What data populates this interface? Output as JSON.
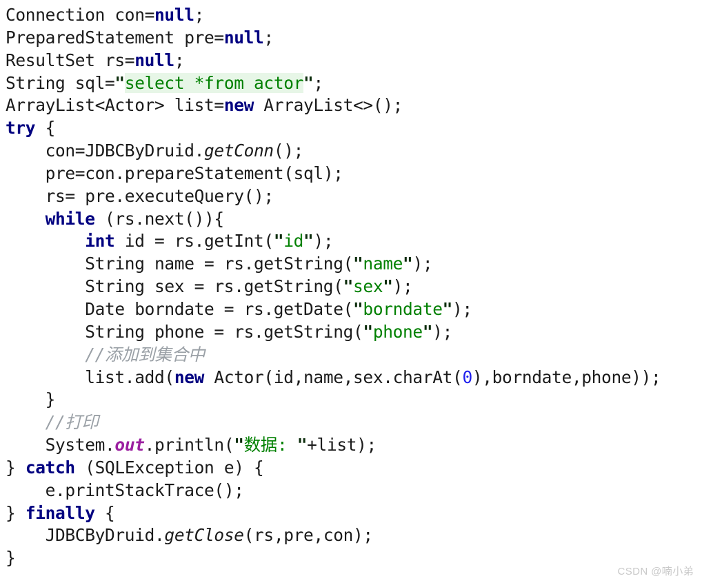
{
  "editor": {
    "language": "java",
    "background": "#ffffff",
    "colors": {
      "plain_text": "#1b1b1b",
      "keyword": "#000080",
      "string": "#008000",
      "string_quote": "#0c2d0c",
      "number": "#2020ee",
      "comment": "#9aa0a6",
      "static_field": "#9b1fa0",
      "sql_injection_highlight": "#e7f6e7",
      "watermark": "#c9c9c9"
    },
    "line_count": 25
  },
  "code": {
    "lines": [
      {
        "n": 1,
        "indent": 0,
        "tokens": [
          {
            "t": "plain",
            "v": "Connection con="
          },
          {
            "t": "kw",
            "v": "null"
          },
          {
            "t": "plain",
            "v": ";"
          }
        ]
      },
      {
        "n": 2,
        "indent": 0,
        "tokens": [
          {
            "t": "plain",
            "v": "PreparedStatement pre="
          },
          {
            "t": "kw",
            "v": "null"
          },
          {
            "t": "plain",
            "v": ";"
          }
        ]
      },
      {
        "n": 3,
        "indent": 0,
        "tokens": [
          {
            "t": "plain",
            "v": "ResultSet rs="
          },
          {
            "t": "kw",
            "v": "null"
          },
          {
            "t": "plain",
            "v": ";"
          }
        ]
      },
      {
        "n": 4,
        "indent": 0,
        "tokens": [
          {
            "t": "plain",
            "v": "String sql="
          },
          {
            "t": "strq",
            "v": "\""
          },
          {
            "t": "sql",
            "v": "select *from actor"
          },
          {
            "t": "strq",
            "v": "\""
          },
          {
            "t": "plain",
            "v": ";"
          }
        ]
      },
      {
        "n": 5,
        "indent": 0,
        "tokens": [
          {
            "t": "plain",
            "v": "ArrayList<Actor> list="
          },
          {
            "t": "kw",
            "v": "new"
          },
          {
            "t": "plain",
            "v": " ArrayList<>();"
          }
        ]
      },
      {
        "n": 6,
        "indent": 0,
        "tokens": [
          {
            "t": "kw",
            "v": "try"
          },
          {
            "t": "plain",
            "v": " {"
          }
        ]
      },
      {
        "n": 7,
        "indent": 1,
        "tokens": [
          {
            "t": "plain",
            "v": "con=JDBCByDruid."
          },
          {
            "t": "method",
            "v": "getConn"
          },
          {
            "t": "plain",
            "v": "();"
          }
        ]
      },
      {
        "n": 8,
        "indent": 1,
        "tokens": [
          {
            "t": "plain",
            "v": "pre=con.prepareStatement(sql);"
          }
        ]
      },
      {
        "n": 9,
        "indent": 1,
        "tokens": [
          {
            "t": "plain",
            "v": "rs= pre.executeQuery();"
          }
        ]
      },
      {
        "n": 10,
        "indent": 1,
        "tokens": [
          {
            "t": "kw",
            "v": "while"
          },
          {
            "t": "plain",
            "v": " (rs.next()){"
          }
        ]
      },
      {
        "n": 11,
        "indent": 2,
        "tokens": [
          {
            "t": "kw",
            "v": "int"
          },
          {
            "t": "plain",
            "v": " id = rs.getInt("
          },
          {
            "t": "strq",
            "v": "\""
          },
          {
            "t": "str",
            "v": "id"
          },
          {
            "t": "strq",
            "v": "\""
          },
          {
            "t": "plain",
            "v": ");"
          }
        ]
      },
      {
        "n": 12,
        "indent": 2,
        "tokens": [
          {
            "t": "plain",
            "v": "String name = rs.getString("
          },
          {
            "t": "strq",
            "v": "\""
          },
          {
            "t": "str",
            "v": "name"
          },
          {
            "t": "strq",
            "v": "\""
          },
          {
            "t": "plain",
            "v": ");"
          }
        ]
      },
      {
        "n": 13,
        "indent": 2,
        "tokens": [
          {
            "t": "plain",
            "v": "String sex = rs.getString("
          },
          {
            "t": "strq",
            "v": "\""
          },
          {
            "t": "str",
            "v": "sex"
          },
          {
            "t": "strq",
            "v": "\""
          },
          {
            "t": "plain",
            "v": ");"
          }
        ]
      },
      {
        "n": 14,
        "indent": 2,
        "tokens": [
          {
            "t": "plain",
            "v": "Date borndate = rs.getDate("
          },
          {
            "t": "strq",
            "v": "\""
          },
          {
            "t": "str",
            "v": "borndate"
          },
          {
            "t": "strq",
            "v": "\""
          },
          {
            "t": "plain",
            "v": ");"
          }
        ]
      },
      {
        "n": 15,
        "indent": 2,
        "tokens": [
          {
            "t": "plain",
            "v": "String phone = rs.getString("
          },
          {
            "t": "strq",
            "v": "\""
          },
          {
            "t": "str",
            "v": "phone"
          },
          {
            "t": "strq",
            "v": "\""
          },
          {
            "t": "plain",
            "v": ");"
          }
        ]
      },
      {
        "n": 16,
        "indent": 2,
        "tokens": [
          {
            "t": "cmt",
            "v": "//添加到集合中"
          }
        ]
      },
      {
        "n": 17,
        "indent": 2,
        "tokens": [
          {
            "t": "plain",
            "v": "list.add("
          },
          {
            "t": "kw",
            "v": "new"
          },
          {
            "t": "plain",
            "v": " Actor(id,name,sex.charAt("
          },
          {
            "t": "num",
            "v": "0"
          },
          {
            "t": "plain",
            "v": "),borndate,phone));"
          }
        ]
      },
      {
        "n": 18,
        "indent": 1,
        "tokens": [
          {
            "t": "plain",
            "v": "}"
          }
        ]
      },
      {
        "n": 19,
        "indent": 1,
        "tokens": [
          {
            "t": "cmt",
            "v": "//打印"
          }
        ]
      },
      {
        "n": 20,
        "indent": 1,
        "tokens": [
          {
            "t": "plain",
            "v": "System."
          },
          {
            "t": "static",
            "v": "out"
          },
          {
            "t": "plain",
            "v": ".println("
          },
          {
            "t": "strq",
            "v": "\""
          },
          {
            "t": "str",
            "v": "数据: "
          },
          {
            "t": "strq",
            "v": "\""
          },
          {
            "t": "plain",
            "v": "+list);"
          }
        ]
      },
      {
        "n": 21,
        "indent": 0,
        "tokens": [
          {
            "t": "plain",
            "v": "} "
          },
          {
            "t": "kw",
            "v": "catch"
          },
          {
            "t": "plain",
            "v": " (SQLException e) {"
          }
        ]
      },
      {
        "n": 22,
        "indent": 1,
        "tokens": [
          {
            "t": "plain",
            "v": "e.printStackTrace();"
          }
        ]
      },
      {
        "n": 23,
        "indent": 0,
        "tokens": [
          {
            "t": "plain",
            "v": "} "
          },
          {
            "t": "kw",
            "v": "finally"
          },
          {
            "t": "plain",
            "v": " {"
          }
        ]
      },
      {
        "n": 24,
        "indent": 1,
        "tokens": [
          {
            "t": "plain",
            "v": "JDBCByDruid."
          },
          {
            "t": "method",
            "v": "getClose"
          },
          {
            "t": "plain",
            "v": "(rs,pre,con);"
          }
        ]
      },
      {
        "n": 25,
        "indent": 0,
        "tokens": [
          {
            "t": "plain",
            "v": "}"
          }
        ]
      }
    ]
  },
  "watermark": {
    "text": "CSDN @喃小弟"
  }
}
